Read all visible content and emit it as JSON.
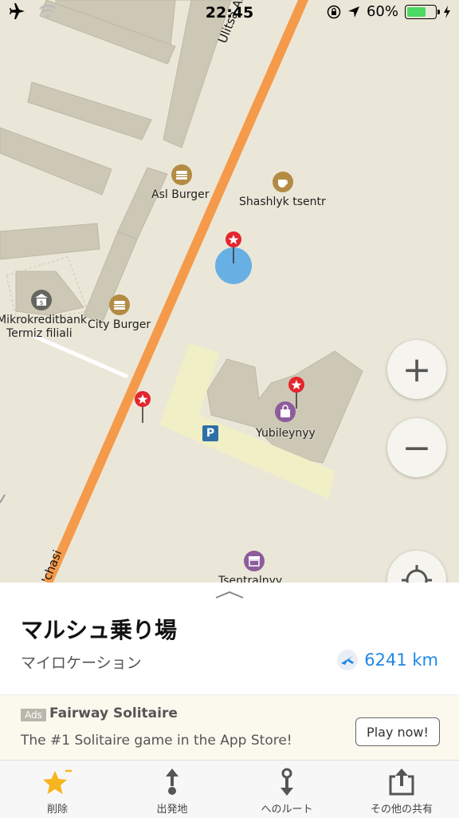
{
  "status_bar": {
    "time": "22:45",
    "battery_percent": "60%",
    "battery_level": 0.6
  },
  "map": {
    "streets": {
      "main_street_label": "Ulitsa At-Termi",
      "bottom_street_label": "o'chasi"
    },
    "pois": [
      {
        "name": "Asl Burger",
        "icon": "burger-icon"
      },
      {
        "name": "Shashlyk tsentr",
        "icon": "coffee-cup-icon"
      },
      {
        "name": "City Burger",
        "icon": "burger-icon"
      },
      {
        "name": "Mikrokreditbank\nTermiz filiali",
        "line1": "Mikrokreditbank",
        "line2": "Termiz filiali",
        "icon": "bank-icon"
      },
      {
        "name": "Yubileynyy",
        "icon": "shopping-bag-icon"
      },
      {
        "name": "Tsentralnyy",
        "icon": "market-icon"
      }
    ],
    "parking_label": "P",
    "controls": {
      "zoom_in": "+",
      "zoom_out": "−"
    }
  },
  "place": {
    "title": "マルシュ乗り場",
    "subtitle": "マイロケーション",
    "distance": "6241 km"
  },
  "ad": {
    "badge": "Ads",
    "title": "Fairway Solitaire",
    "description": "The #1 Solitaire game in the App Store!",
    "button": "Play now!"
  },
  "tabbar": [
    {
      "label": "削除",
      "icon": "star-icon"
    },
    {
      "label": "出発地",
      "icon": "route-start-icon"
    },
    {
      "label": "へのルート",
      "icon": "route-end-icon"
    },
    {
      "label": "その他の共有",
      "icon": "share-icon"
    }
  ],
  "colors": {
    "map_background": "#ebe7d8",
    "main_road": "#f59a4a",
    "building": "#cdc8b6",
    "accent_blue": "#1e88e5",
    "location_dot": "#5aa9e6",
    "pin_red": "#e3262e"
  }
}
